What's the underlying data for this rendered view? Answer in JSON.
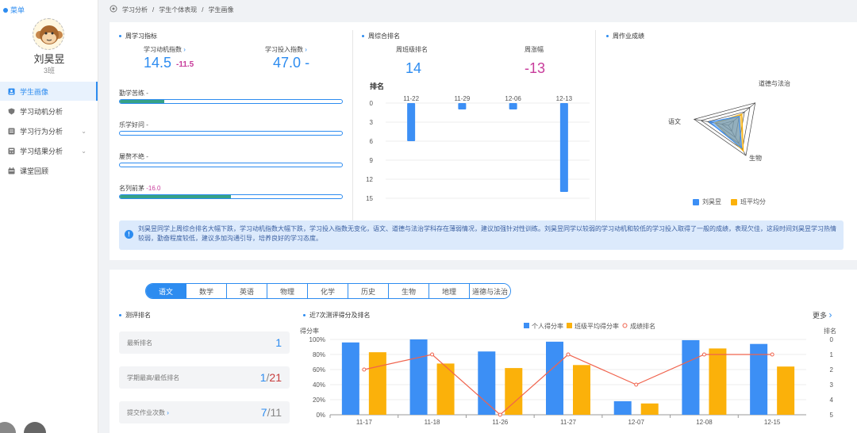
{
  "sidebar": {
    "menu_label": "菜单",
    "user_name": "刘昊昱",
    "user_class": "3班",
    "items": [
      {
        "label": "学生画像",
        "active": true,
        "icon": "id-card-icon"
      },
      {
        "label": "学习动机分析",
        "icon": "shield-icon"
      },
      {
        "label": "学习行为分析",
        "icon": "clipboard-icon",
        "expandable": true
      },
      {
        "label": "学习结果分析",
        "icon": "calculator-icon",
        "expandable": true
      },
      {
        "label": "课堂回顾",
        "icon": "calendar-icon"
      }
    ]
  },
  "breadcrumb": {
    "home_icon": "target-icon",
    "items": [
      "学习分析",
      "学生个体表现",
      "学生画像"
    ],
    "sep": "/"
  },
  "weekly_index": {
    "title": "周学习指标",
    "motivation": {
      "label": "学习动机指数",
      "value": "14.5",
      "delta": "-11.5"
    },
    "investment": {
      "label": "学习投入指数",
      "value": "47.0",
      "delta": "-"
    },
    "bars": [
      {
        "label": "勤学苦练",
        "suffix": "-",
        "fill": 0.2
      },
      {
        "label": "乐学好问",
        "suffix": "-",
        "fill": 0
      },
      {
        "label": "屡赘不绝",
        "suffix": "-",
        "fill": 0
      },
      {
        "label": "名列前茅",
        "suffix": "-16.0",
        "fill": 0.5
      }
    ]
  },
  "weekly_rank": {
    "title": "周综合排名",
    "class_rank_label": "周班级排名",
    "class_rank_value": "14",
    "change_label": "周涨幅",
    "change_value": "-13",
    "chart_ylabel": "排名"
  },
  "weekly_homework": {
    "title": "周作业成绩",
    "axes": [
      "道德与法治",
      "语文",
      "生物"
    ],
    "legend": [
      "刘昊昱",
      "班平均分"
    ]
  },
  "note_text": "刘昊昱同学上周综合排名大幅下跌，学习动机指数大幅下跌，学习投入指数无变化，语文、道德与法治学科存在薄弱情况，建议加强针对性训练。刘昊昱同学以较弱的学习动机和较低的学习投入取得了一般的成绩，表现欠佳，这段时间刘昊昱学习热情较弱，勤奋程度较低，建议多加沟通引导，培养良好的学习态度。",
  "subject_tabs": [
    "语文",
    "数学",
    "英语",
    "物理",
    "化学",
    "历史",
    "生物",
    "地理",
    "道德与法治"
  ],
  "eval_rank": {
    "title": "测评排名",
    "latest": {
      "label": "最新排名",
      "value": "1"
    },
    "best_worst": {
      "label": "学期最高/最低排名",
      "best": "1",
      "sep": "/",
      "worst": "21"
    },
    "submit": {
      "label": "提交作业次数",
      "done": "7",
      "sep": "/",
      "total": "11"
    }
  },
  "recent_chart": {
    "title": "近7次测评得分及排名",
    "more": "更多",
    "left_axis_label": "得分率",
    "right_axis_label": "排名"
  },
  "colors": {
    "blue": "#3c8ff5",
    "orange": "#fbb10a",
    "red": "#f0634d",
    "green": "#36a186",
    "purple": "#c83c9b"
  },
  "chart_data": [
    {
      "type": "bar",
      "title": "",
      "ylabel": "排名",
      "categories": [
        "11-22",
        "11-29",
        "12-06",
        "12-13"
      ],
      "values": [
        6,
        1,
        1,
        14
      ],
      "ylim": [
        0,
        15
      ],
      "yticks": [
        0,
        3,
        6,
        9,
        12,
        15
      ],
      "inverted_y": true
    },
    {
      "type": "radar",
      "axes": [
        "道德与法治",
        "语文",
        "生物"
      ],
      "max": 100,
      "series": [
        {
          "name": "刘昊昱",
          "values": [
            40,
            55,
            75
          ]
        },
        {
          "name": "班平均分",
          "values": [
            50,
            40,
            85
          ]
        }
      ]
    },
    {
      "type": "bar+line",
      "categories": [
        "11-17",
        "11-18",
        "11-26",
        "11-27",
        "12-07",
        "12-08",
        "12-15"
      ],
      "ylim": [
        0,
        100
      ],
      "yticks": [
        "0%",
        "20%",
        "40%",
        "60%",
        "80%",
        "100%"
      ],
      "y2lim": [
        0,
        5
      ],
      "y2ticks": [
        0,
        1,
        2,
        3,
        4,
        5
      ],
      "series": [
        {
          "name": "个人得分率",
          "values": [
            96,
            100,
            84,
            97,
            18,
            99,
            94
          ]
        },
        {
          "name": "班级平均得分率",
          "values": [
            83,
            68,
            62,
            66,
            15,
            88,
            64
          ]
        },
        {
          "name": "成绩排名",
          "axis": "right",
          "values": [
            2,
            1,
            5,
            1,
            3,
            1,
            1
          ]
        }
      ]
    }
  ]
}
